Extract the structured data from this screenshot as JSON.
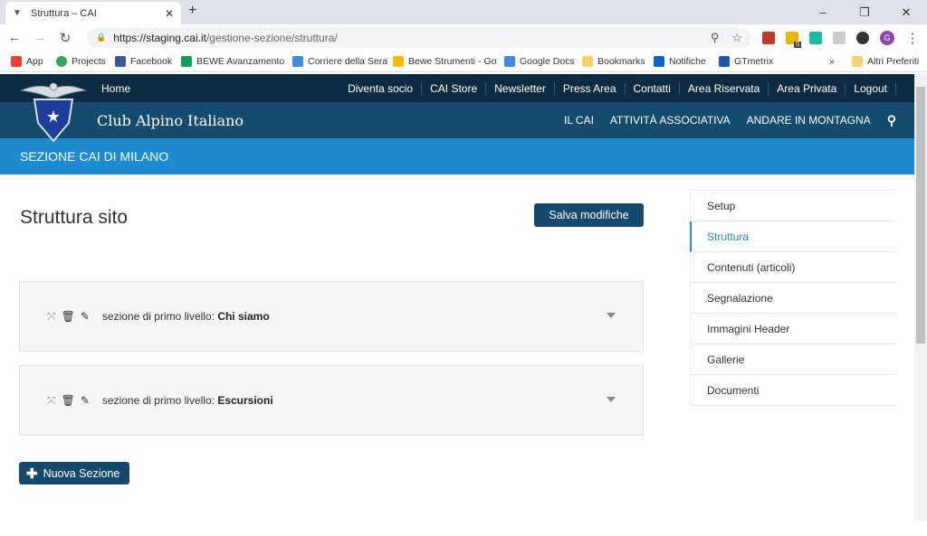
{
  "browser": {
    "tab_title": "Struttura – CAI",
    "url_host": "https://staging.cai.it",
    "url_path": "/gestione-sezione/struttura/",
    "profile_initial": "G",
    "ext_badge": "5",
    "bookmarks": [
      {
        "label": "App",
        "icon": "apps-grid-icon",
        "color": "#e94235"
      },
      {
        "label": "Projects",
        "icon": "projects-icon",
        "color": "#34a853"
      },
      {
        "label": "Facebook",
        "icon": "facebook-icon",
        "color": "#3b5998"
      },
      {
        "label": "BEWE Avanzamento",
        "icon": "sheets-icon",
        "color": "#0f9d58"
      },
      {
        "label": "Corriere della Sera",
        "icon": "corriere-icon",
        "color": "#3d8fe0"
      },
      {
        "label": "Bewe Strumenti - Go",
        "icon": "drive-icon",
        "color": "#fbbc04"
      },
      {
        "label": "Google Docs",
        "icon": "docs-icon",
        "color": "#4285f4"
      },
      {
        "label": "Bookmarks",
        "icon": "folder-icon",
        "color": "#f5d36b"
      },
      {
        "label": "Notifiche",
        "icon": "linkedin-icon",
        "color": "#0a66c2"
      },
      {
        "label": "GTmetrix",
        "icon": "gtmetrix-icon",
        "color": "#1c5aa6"
      }
    ],
    "more_bookmarks": "»",
    "other_bookmarks": "Altri Preferiti"
  },
  "site": {
    "home": "Home",
    "top_links": [
      "Diventa socio",
      "CAI Store",
      "Newsletter",
      "Press Area",
      "Contatti",
      "Area Riservata",
      "Area Privata",
      "Logout"
    ],
    "brand": "Club Alpino Italiano",
    "main_nav": [
      "IL CAI",
      "ATTIVITÀ ASSOCIATIVA",
      "ANDARE IN MONTAGNA"
    ],
    "section_band": "SEZIONE CAI DI MILANO"
  },
  "main": {
    "title": "Struttura sito",
    "save_label": "Salva modifiche",
    "sections": [
      {
        "prefix": "sezione di primo livello:",
        "name": "Chi siamo"
      },
      {
        "prefix": "sezione di primo livello:",
        "name": "Escursioni"
      }
    ],
    "new_section_label": "Nuova Sezione"
  },
  "sidebar": {
    "items": [
      {
        "label": "Setup",
        "active": false
      },
      {
        "label": "Struttura",
        "active": true
      },
      {
        "label": "Contenuti (articoli)",
        "active": false
      },
      {
        "label": "Segnalazione",
        "active": false
      },
      {
        "label": "Immagini Header",
        "active": false
      },
      {
        "label": "Gallerie",
        "active": false
      },
      {
        "label": "Documenti",
        "active": false
      }
    ]
  },
  "colors": {
    "nav_dark": "#0d2c42",
    "logo_bar": "#144b6e",
    "band": "#1e8bd0",
    "button": "#154a6e",
    "active": "#2a7fc4"
  }
}
